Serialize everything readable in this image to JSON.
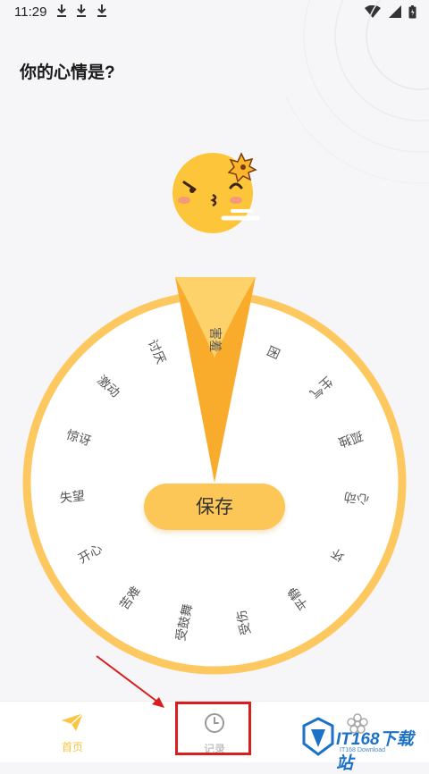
{
  "status_bar": {
    "time": "11:29"
  },
  "question": "你的心情是?",
  "moods": [
    "害羞",
    "困",
    "生气",
    "孤独",
    "心动",
    "坏",
    "平静",
    "受伤",
    "受鼓舞",
    "苦难",
    "开心",
    "失望",
    "惊讶",
    "激动",
    "讨厌"
  ],
  "save_label": "保存",
  "nav": {
    "home_label": "首页",
    "record_label": "记录"
  },
  "watermark": {
    "brand": "IT168下载站",
    "sub": "IT168 Download"
  },
  "colors": {
    "accent": "#fdc757",
    "pointer": "#f9ab2c",
    "highlight": "#d81e1e"
  }
}
